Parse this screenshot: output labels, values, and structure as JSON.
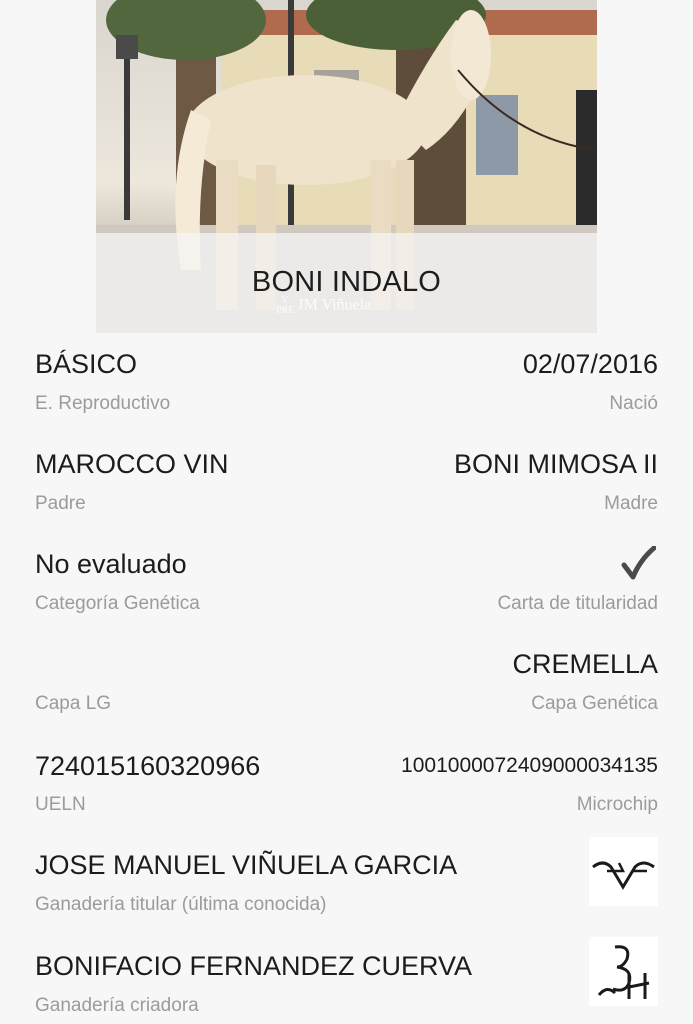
{
  "header": {
    "horse_name": "BONI INDALO",
    "watermark": "JM Viñuela",
    "watermark_mark_top": "V",
    "watermark_mark_bottom": "PRE"
  },
  "fields": {
    "estado_reproductivo": {
      "value": "BÁSICO",
      "label": "E. Reproductivo"
    },
    "nacio": {
      "value": "02/07/2016",
      "label": "Nació"
    },
    "padre": {
      "value": "MAROCCO VIN",
      "label": "Padre"
    },
    "madre": {
      "value": "BONI MIMOSA II",
      "label": "Madre"
    },
    "categoria_genetica": {
      "value": "No evaluado",
      "label": "Categoría Genética"
    },
    "carta_titularidad": {
      "value": "checked",
      "icon": "checkmark-icon",
      "label": "Carta de titularidad"
    },
    "capa_lg": {
      "value": "",
      "label": "Capa LG"
    },
    "capa_genetica": {
      "value": "CREMELLA",
      "label": "Capa Genética"
    },
    "ueln": {
      "value": "724015160320966",
      "label": "UELN"
    },
    "microchip": {
      "value": "1001000072409000034135",
      "label": "Microchip"
    },
    "ganaderia_titular": {
      "value": "JOSE MANUEL VIÑUELA GARCIA",
      "label": "Ganadería titular (última conocida)",
      "brand_icon": "brand-mark-icon"
    },
    "ganaderia_criadora": {
      "value": "BONIFACIO FERNANDEZ CUERVA",
      "label": "Ganadería criadora",
      "brand_icon": "brand-mark-icon"
    }
  },
  "colors": {
    "background": "#f7f7f7",
    "value_text": "#1c1c1c",
    "label_text": "#9b9b9b"
  }
}
